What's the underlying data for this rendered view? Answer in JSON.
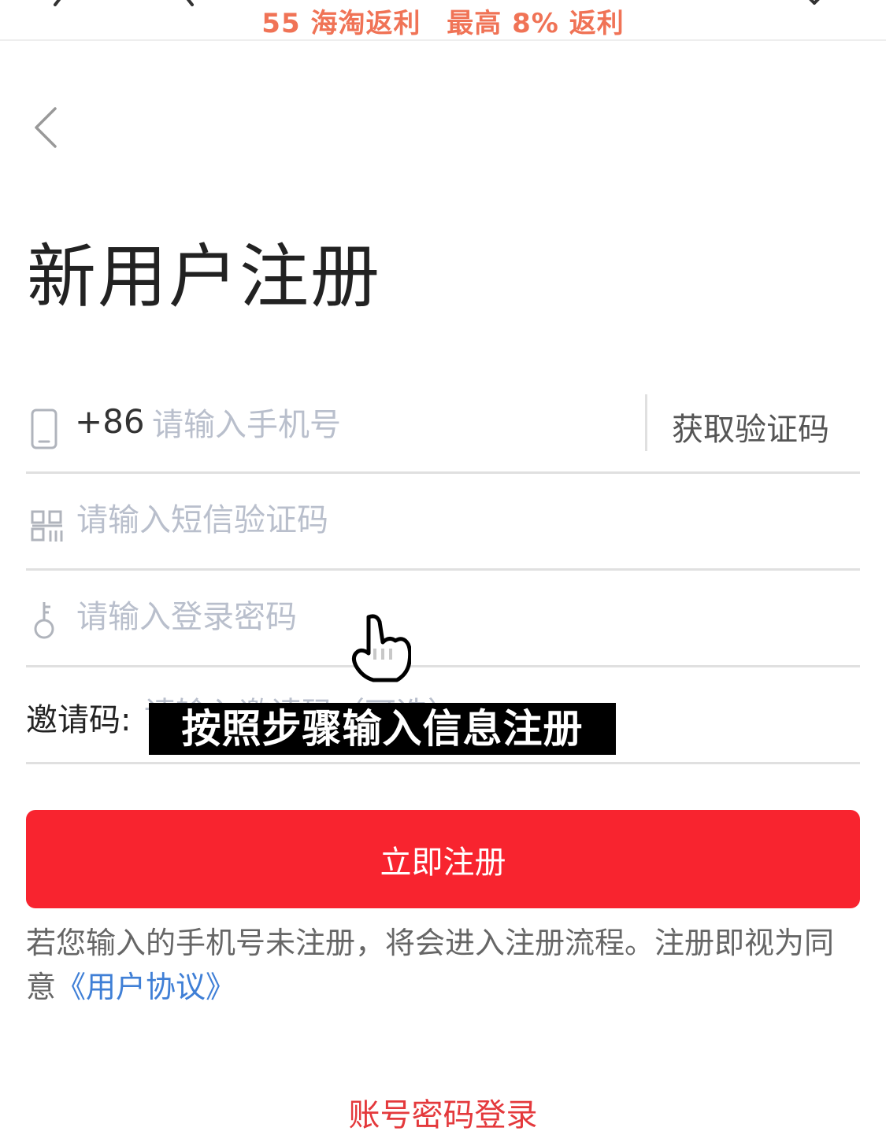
{
  "header": {
    "brand": "55 海淘返利",
    "slogan": "最高 8% 返利"
  },
  "page_title": "新用户注册",
  "form": {
    "phone": {
      "prefix": "+86",
      "placeholder": "请输入手机号",
      "get_code_label": "获取验证码",
      "icon": "phone-icon"
    },
    "sms_code": {
      "placeholder": "请输入短信验证码",
      "icon": "qr-code-icon"
    },
    "password": {
      "placeholder": "请输入登录密码",
      "icon": "key-icon"
    },
    "invite": {
      "label": "邀请码:",
      "placeholder": "请输入邀请码（可选）"
    },
    "submit_label": "立即注册"
  },
  "notice": {
    "text": "若您输入的手机号未注册，将会进入注册流程。注册即视为同意",
    "link": "《用户协议》"
  },
  "overlay_caption": "按照步骤输入信息注册",
  "bottom_link": "账号密码登录",
  "colors": {
    "accent_red": "#f8242f",
    "header_orange": "#f07356",
    "link_blue": "#3f7fd6",
    "placeholder_gray": "#b9bfcc"
  }
}
